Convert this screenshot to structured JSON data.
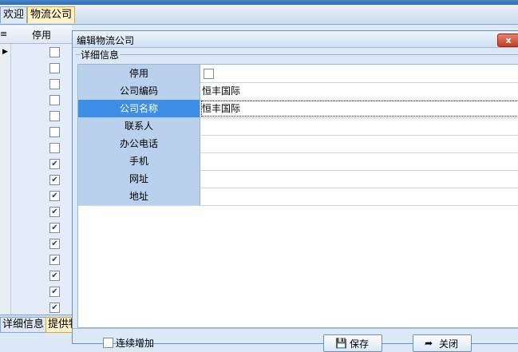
{
  "tabs": [
    {
      "label": "欢迎",
      "active": false
    },
    {
      "label": "物流公司",
      "active": true
    }
  ],
  "grid": {
    "menu_icon": "menu-icon",
    "column_header": "停用",
    "rows": [
      {
        "current": true,
        "checked": false
      },
      {
        "current": false,
        "checked": false
      },
      {
        "current": false,
        "checked": false
      },
      {
        "current": false,
        "checked": false
      },
      {
        "current": false,
        "checked": false
      },
      {
        "current": false,
        "checked": false
      },
      {
        "current": false,
        "checked": false
      },
      {
        "current": false,
        "checked": true
      },
      {
        "current": false,
        "checked": true
      },
      {
        "current": false,
        "checked": true
      },
      {
        "current": false,
        "checked": true
      },
      {
        "current": false,
        "checked": true
      },
      {
        "current": false,
        "checked": true
      },
      {
        "current": false,
        "checked": true
      },
      {
        "current": false,
        "checked": true
      },
      {
        "current": false,
        "checked": true
      },
      {
        "current": false,
        "checked": true
      }
    ]
  },
  "bottom_tabs": [
    {
      "label": "详细信息",
      "active": false
    },
    {
      "label": "提供物",
      "active": true
    }
  ],
  "dialog": {
    "title": "编辑物流公司",
    "close_label": "x",
    "group_label": "详细信息",
    "fields": [
      {
        "label": "停用",
        "type": "checkbox",
        "checked": false,
        "value": ""
      },
      {
        "label": "公司编码",
        "type": "text",
        "value": "恒丰国际"
      },
      {
        "label": "公司名称",
        "type": "text",
        "value": "恒丰国际",
        "selected": true
      },
      {
        "label": "联系人",
        "type": "text",
        "value": ""
      },
      {
        "label": "办公电话",
        "type": "text",
        "value": ""
      },
      {
        "label": "手机",
        "type": "text",
        "value": ""
      },
      {
        "label": "网址",
        "type": "text",
        "value": ""
      },
      {
        "label": "地址",
        "type": "text",
        "value": ""
      }
    ],
    "continuous_add_label": "连续增加",
    "save_label": "保存",
    "close_button_label": "关闭"
  },
  "colors": {
    "label_bg": "#b9d1ec",
    "selected_label_bg": "#3d8ee6",
    "active_tab_bg": "#fff2c6"
  }
}
